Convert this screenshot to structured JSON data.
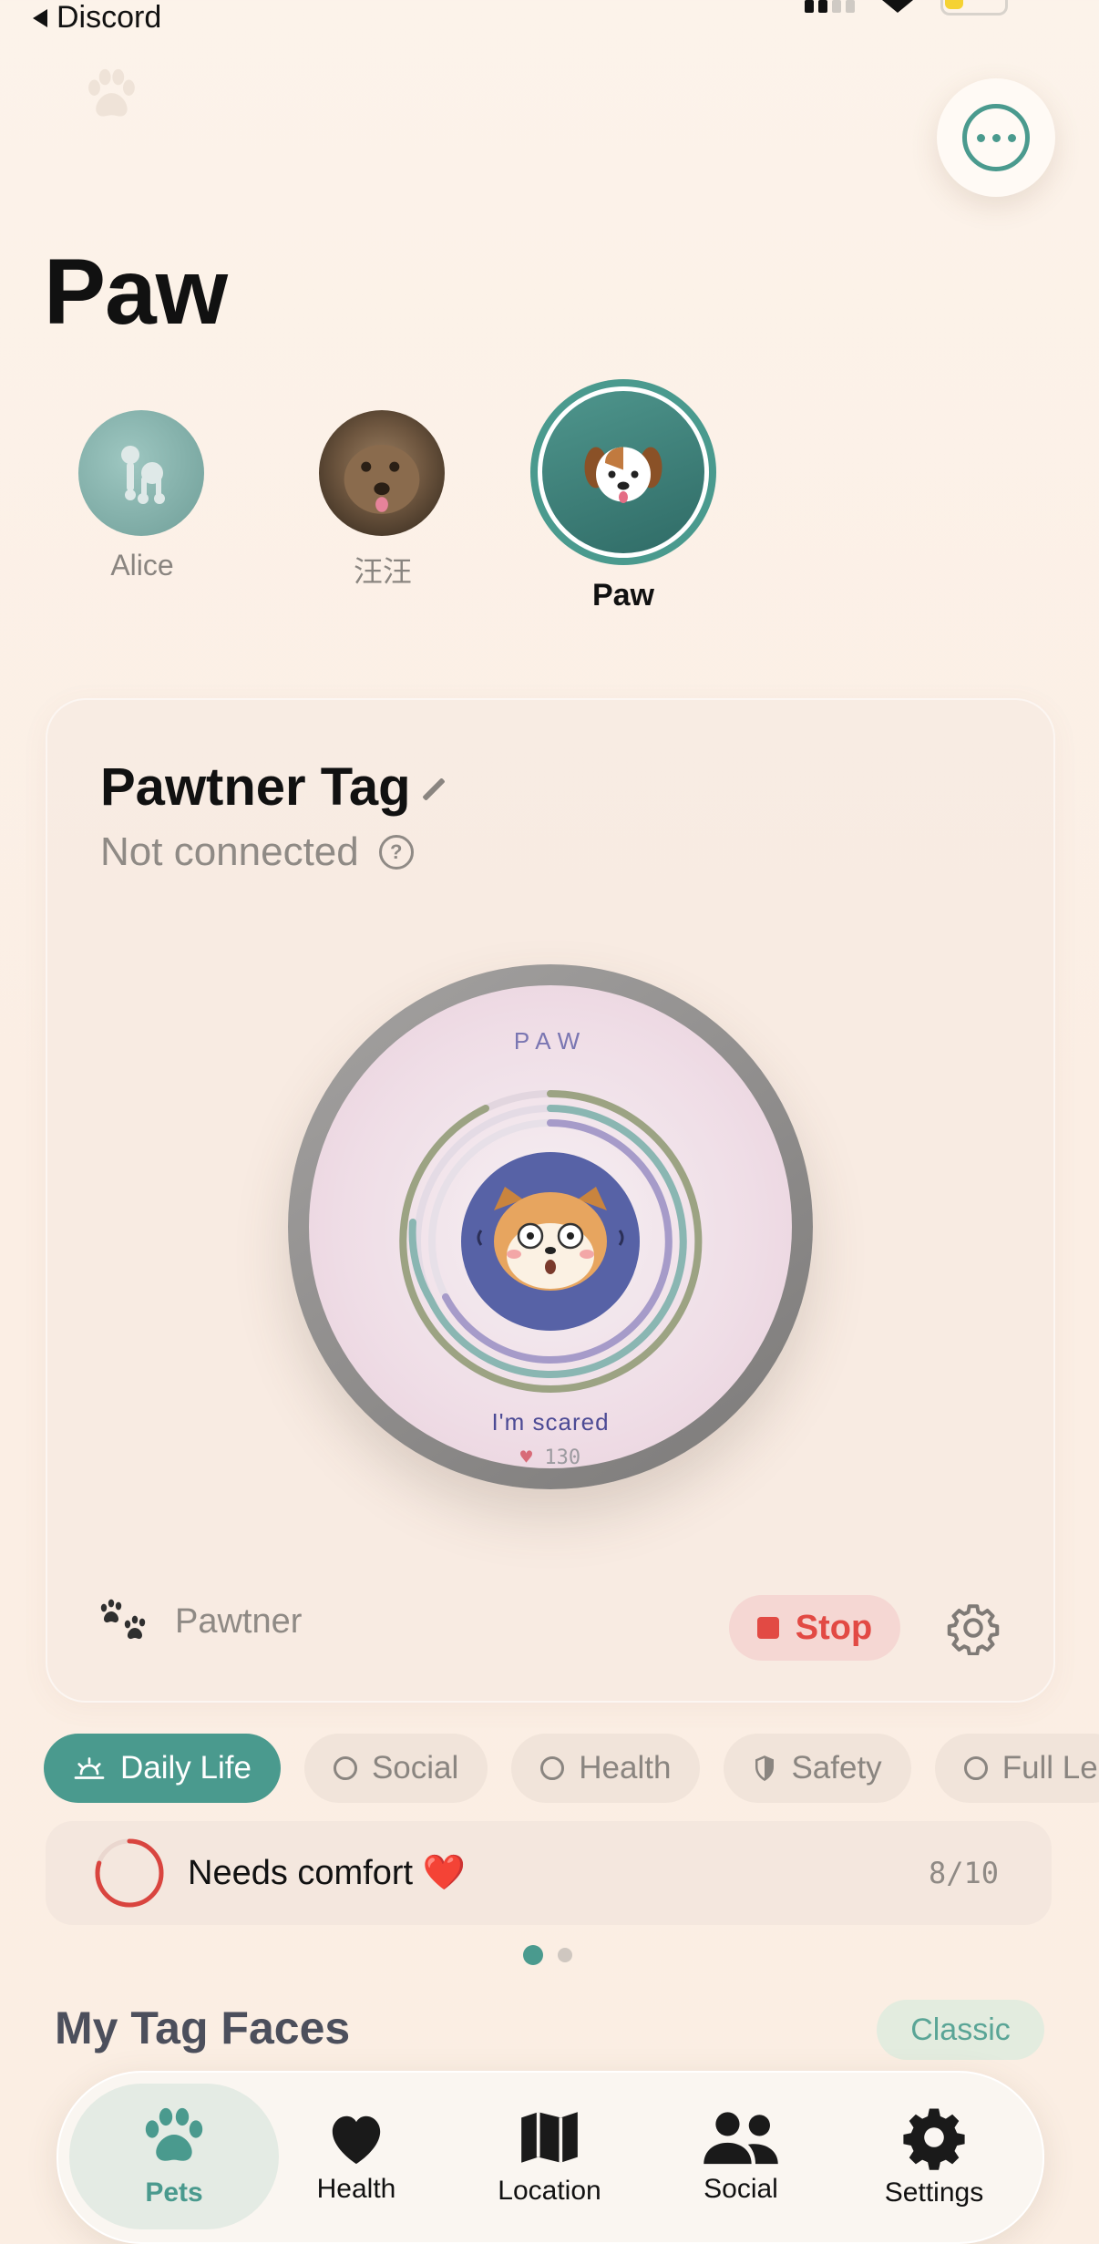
{
  "status_bar": {
    "back_label": "Discord"
  },
  "header": {
    "title": "Paw"
  },
  "pets": [
    {
      "name": "Alice",
      "active": false
    },
    {
      "name": "汪汪",
      "active": false
    },
    {
      "name": "Paw",
      "active": true
    }
  ],
  "tag_card": {
    "title": "Pawtner Tag",
    "status": "Not connected",
    "help_glyph": "?",
    "device": {
      "name": "PAW",
      "mood": "I'm scared",
      "heart_icon": "♥",
      "heart_count": "130"
    },
    "brand": "Pawtner",
    "stop_label": "Stop"
  },
  "chips": [
    {
      "label": "Daily Life",
      "icon": "sunrise-icon",
      "active": true
    },
    {
      "label": "Social",
      "icon": "heart-circle-icon",
      "active": false
    },
    {
      "label": "Health",
      "icon": "plus-circle-icon",
      "active": false
    },
    {
      "label": "Safety",
      "icon": "shield-icon",
      "active": false
    },
    {
      "label": "Full Le",
      "icon": "play-circle-icon",
      "active": false
    }
  ],
  "status_strip": {
    "text": "Needs comfort ❤️",
    "count": "8/10",
    "progress": 0.8
  },
  "pager": {
    "pages": 2,
    "current": 1
  },
  "faces_section": {
    "title": "My Tag Faces",
    "badge": "Classic"
  },
  "tabbar": [
    {
      "label": "Pets",
      "icon": "paw-icon",
      "active": true
    },
    {
      "label": "Health",
      "icon": "heart-icon",
      "active": false
    },
    {
      "label": "Location",
      "icon": "map-icon",
      "active": false
    },
    {
      "label": "Social",
      "icon": "people-icon",
      "active": false
    },
    {
      "label": "Settings",
      "icon": "gear-icon",
      "active": false
    }
  ],
  "colors": {
    "accent": "#4a9a8e",
    "stop": "#e24a44",
    "background": "#fcf3ea"
  }
}
